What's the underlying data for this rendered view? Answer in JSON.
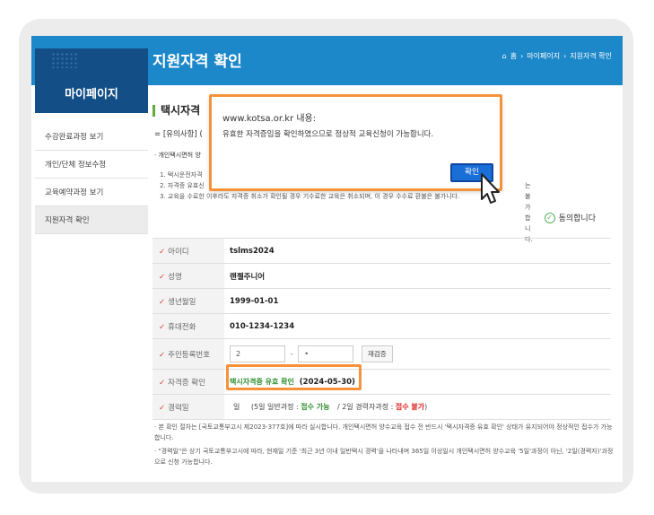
{
  "header": {
    "section_title": "마이페이지",
    "page_title": "지원자격 확인",
    "breadcrumb": [
      "홈",
      "마이페이지",
      "지원자격 확인"
    ]
  },
  "sidebar": {
    "items": [
      {
        "label": "수강완료과정 보기"
      },
      {
        "label": "개인/단체 정보수정"
      },
      {
        "label": "교육예약과정 보기"
      },
      {
        "label": "지원자격 확인"
      }
    ]
  },
  "main": {
    "subtitle": "택시자격",
    "notice": "= [유의사항] (",
    "section_label": "· 개인택시면허 양",
    "rules": [
      "1. 택시운전자격",
      "2. 자격증 유효신",
      "3. 교육을 수료한 이후라도 자격증 취소가 확인될 경우 기수료한 교육은 취소되며, 이 경우 수수료 환불은 불가"
    ],
    "rule2_tail": "는 불가합니다.",
    "rule3_tail": "니다.",
    "agree_label": "동의합니다"
  },
  "form": {
    "rows": [
      {
        "label": "아이디",
        "value": "tslms2024"
      },
      {
        "label": "성명",
        "value": "랜젤주니어"
      },
      {
        "label": "생년월일",
        "value": "1999-01-01"
      },
      {
        "label": "휴대전화",
        "value": "010-1234-1234"
      }
    ],
    "rrn_label": "주민등록번호",
    "rrn_first": "2",
    "rrn_sep": "-",
    "rrn_second": "•",
    "recheck_label": "재검증",
    "license_label": "자격증 확인",
    "license_status": "택시자격증 유효 확인",
    "license_date": "(2024-05-30)",
    "career_label": "경력일",
    "career_unit": "일",
    "career_open": "(5일 일반과정 :",
    "career_possible": "접수 가능",
    "career_mid": "/ 2일 경력자과정 :",
    "career_impossible": "접수 불가",
    "career_close": ")"
  },
  "footnotes": [
    "· 본 확인 절차는 [국토교통부고시 제2023-377호]에 따라 실시합니다. 개인택시면허 양수교육 접수 전 반드시 '택시자격증 유효 확인' 상태가 유지되어야 정상적인 접수가 가능합니다.",
    "· \"경력일\"은 상기 국토교통부고시에 따라, 현재일 기준 '최근 3년 이내 일반택시 경력'을 나타내며 365일 이상일시 개인택시면허 양수교육 '5일'과정이 아닌, '2일(경력자)'과정으로 신청 가능합니다."
  ],
  "dialog": {
    "title": "www.kotsa.or.kr 내용:",
    "message": "유효한 자격증임을 확인하였으므로 정상적 교육신청이 가능합니다.",
    "ok_label": "확인"
  },
  "colors": {
    "header_blue": "#1c87c9",
    "side_navy": "#134f86",
    "highlight_orange": "#f7923a",
    "dialog_button": "#1a6ed8"
  }
}
